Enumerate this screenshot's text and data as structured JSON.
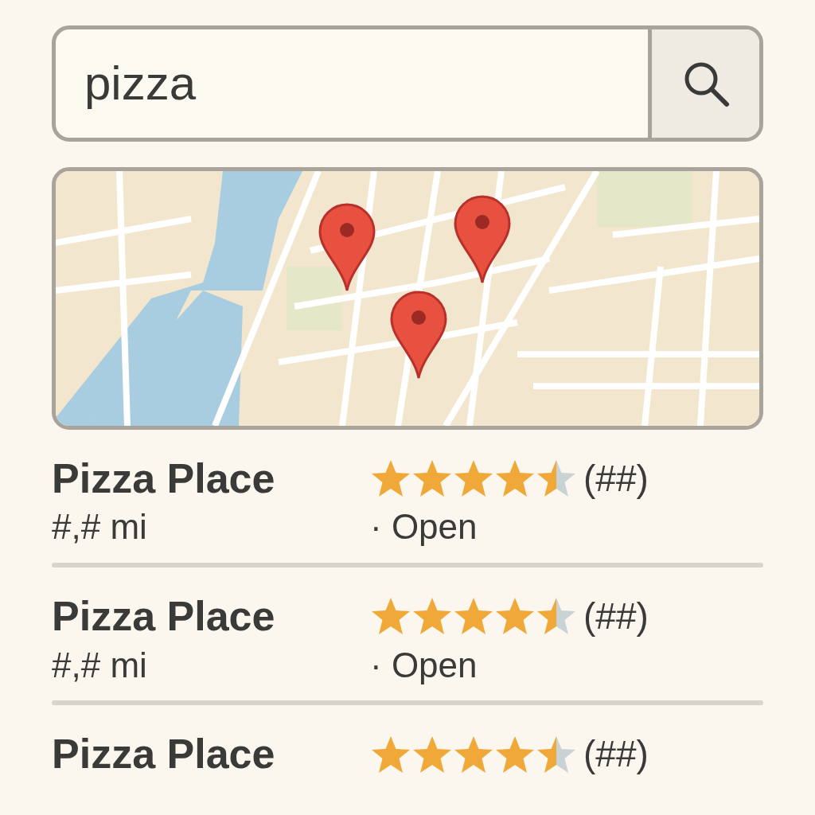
{
  "search": {
    "value": "pizza"
  },
  "results": [
    {
      "name": "Pizza Place",
      "stars": 4.5,
      "count": "(##)",
      "distance": "#,# mi",
      "status": "· Open"
    },
    {
      "name": "Pizza Place",
      "stars": 4.5,
      "count": "(##)",
      "distance": "#,# mi",
      "status": "· Open"
    },
    {
      "name": "Pizza Place",
      "stars": 4.5,
      "count": "(##)"
    }
  ]
}
